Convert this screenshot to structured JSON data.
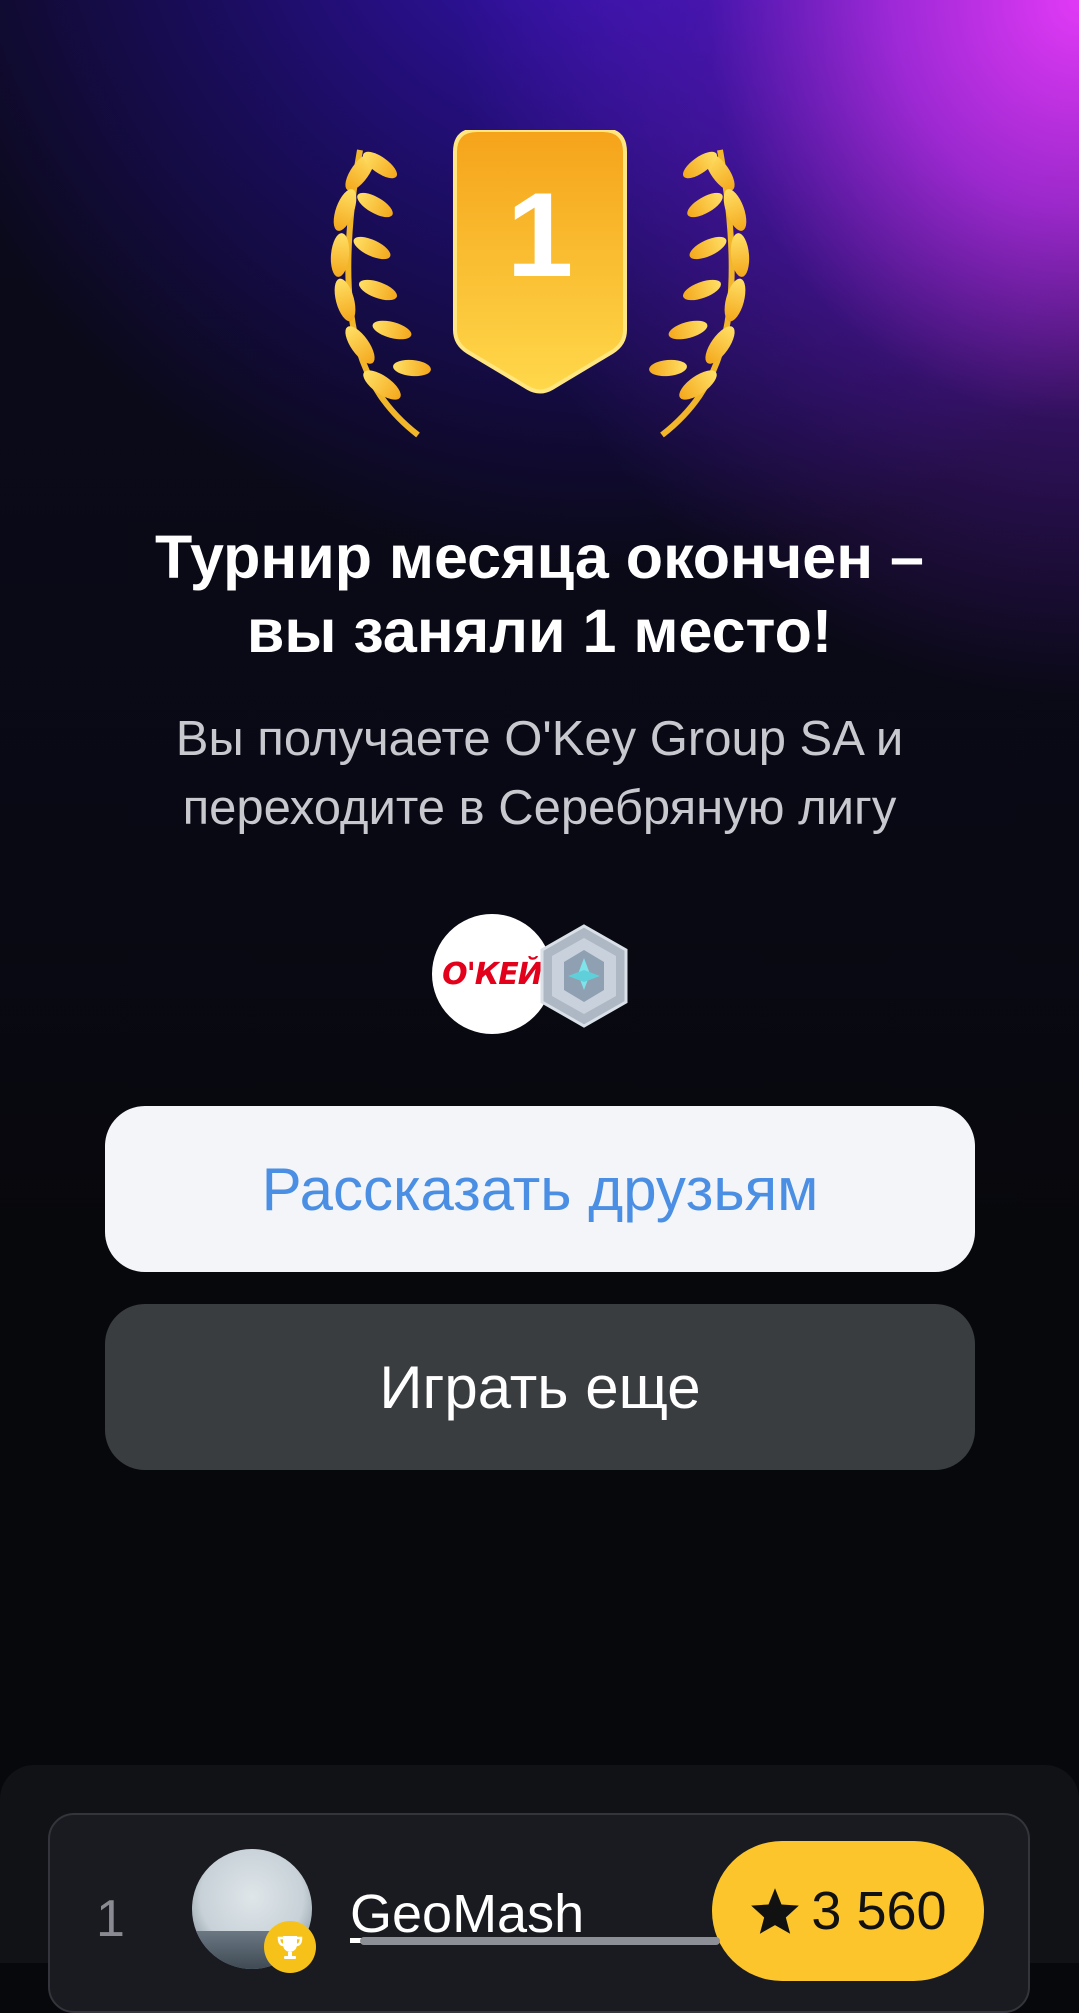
{
  "hero": {
    "place_number": "1",
    "colors": {
      "shield": "#f7c12c",
      "laurel": "#f7c435"
    }
  },
  "result": {
    "title": "Турнир месяца окончен –\nвы заняли 1 место!",
    "subtitle": "Вы получаете O'Key Group SA и\nпереходите в Серебряную лигу"
  },
  "rewards": {
    "company_logo_text": "О'КЕЙ",
    "company_icon": "okey-logo",
    "league_icon": "silver-league-badge-icon"
  },
  "buttons": {
    "share_label": "Рассказать друзьям",
    "play_again_label": "Играть еще"
  },
  "leaderboard": {
    "rows": [
      {
        "rank": "1",
        "name": "GeoMash",
        "score": "3 560",
        "badge_icon": "trophy-icon",
        "score_icon": "star-icon"
      }
    ]
  },
  "colors": {
    "accent_magenta": "#ec3cff",
    "accent_blue": "#3c14c8",
    "button_light": "#f3f5f8",
    "button_dark": "#3a3d40",
    "link_blue": "#4a8fe3",
    "score_yellow": "#fbc52b"
  }
}
